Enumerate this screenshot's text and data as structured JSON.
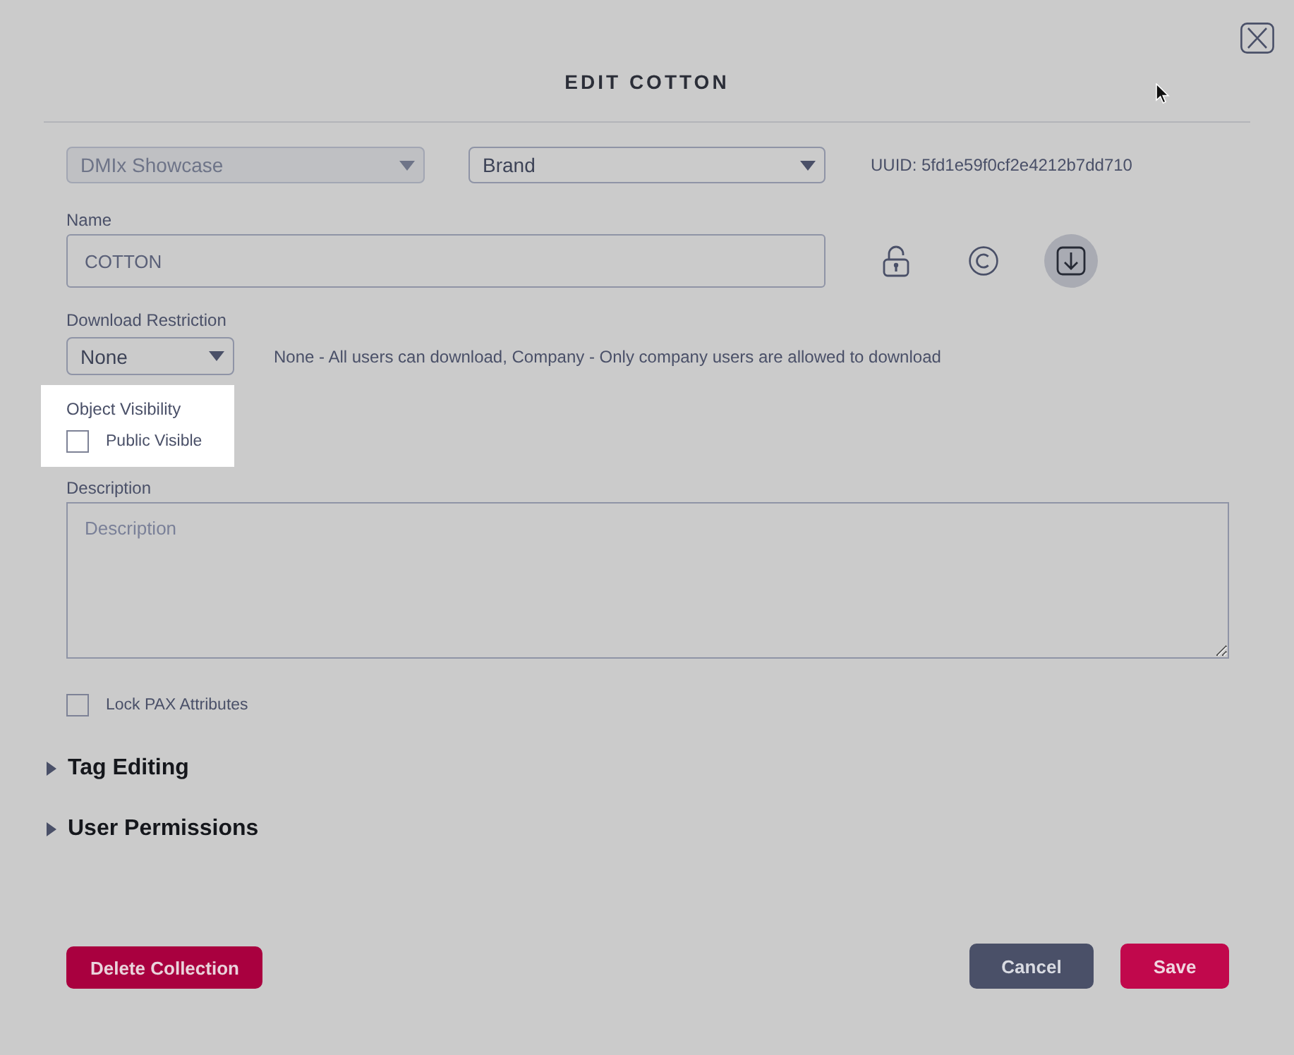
{
  "dialog": {
    "title": "EDIT COTTON"
  },
  "selects": [
    {
      "value": "DMIx Showcase",
      "disabled": true
    },
    {
      "value": "Brand",
      "disabled": false
    }
  ],
  "uuid": "UUID: 5fd1e59f0cf2e4212b7dd710",
  "name_field": {
    "label": "Name",
    "value": "COTTON"
  },
  "icon_buttons": [
    {
      "kind": "lock",
      "selected": false
    },
    {
      "kind": "copyright",
      "selected": false
    },
    {
      "kind": "download",
      "selected": true
    }
  ],
  "download_restriction": {
    "label": "Download Restriction",
    "value": "None",
    "help": "None - All users can download, Company - Only company users are allowed to download"
  },
  "object_visibility": {
    "label": "Object Visibility",
    "highlighted": true,
    "checkbox": {
      "label": "Public Visible",
      "checked": false
    }
  },
  "description": {
    "label": "Description",
    "placeholder": "Description"
  },
  "lock_pax": {
    "label": "Lock PAX Attributes",
    "checked": false
  },
  "sections": [
    {
      "title": "Tag Editing",
      "expanded": false
    },
    {
      "title": "User Permissions",
      "expanded": false
    }
  ],
  "buttons": [
    {
      "label": "Delete Collection",
      "kind": "danger"
    },
    {
      "label": "Cancel",
      "kind": "secondary"
    },
    {
      "label": "Save",
      "kind": "primary"
    }
  ]
}
